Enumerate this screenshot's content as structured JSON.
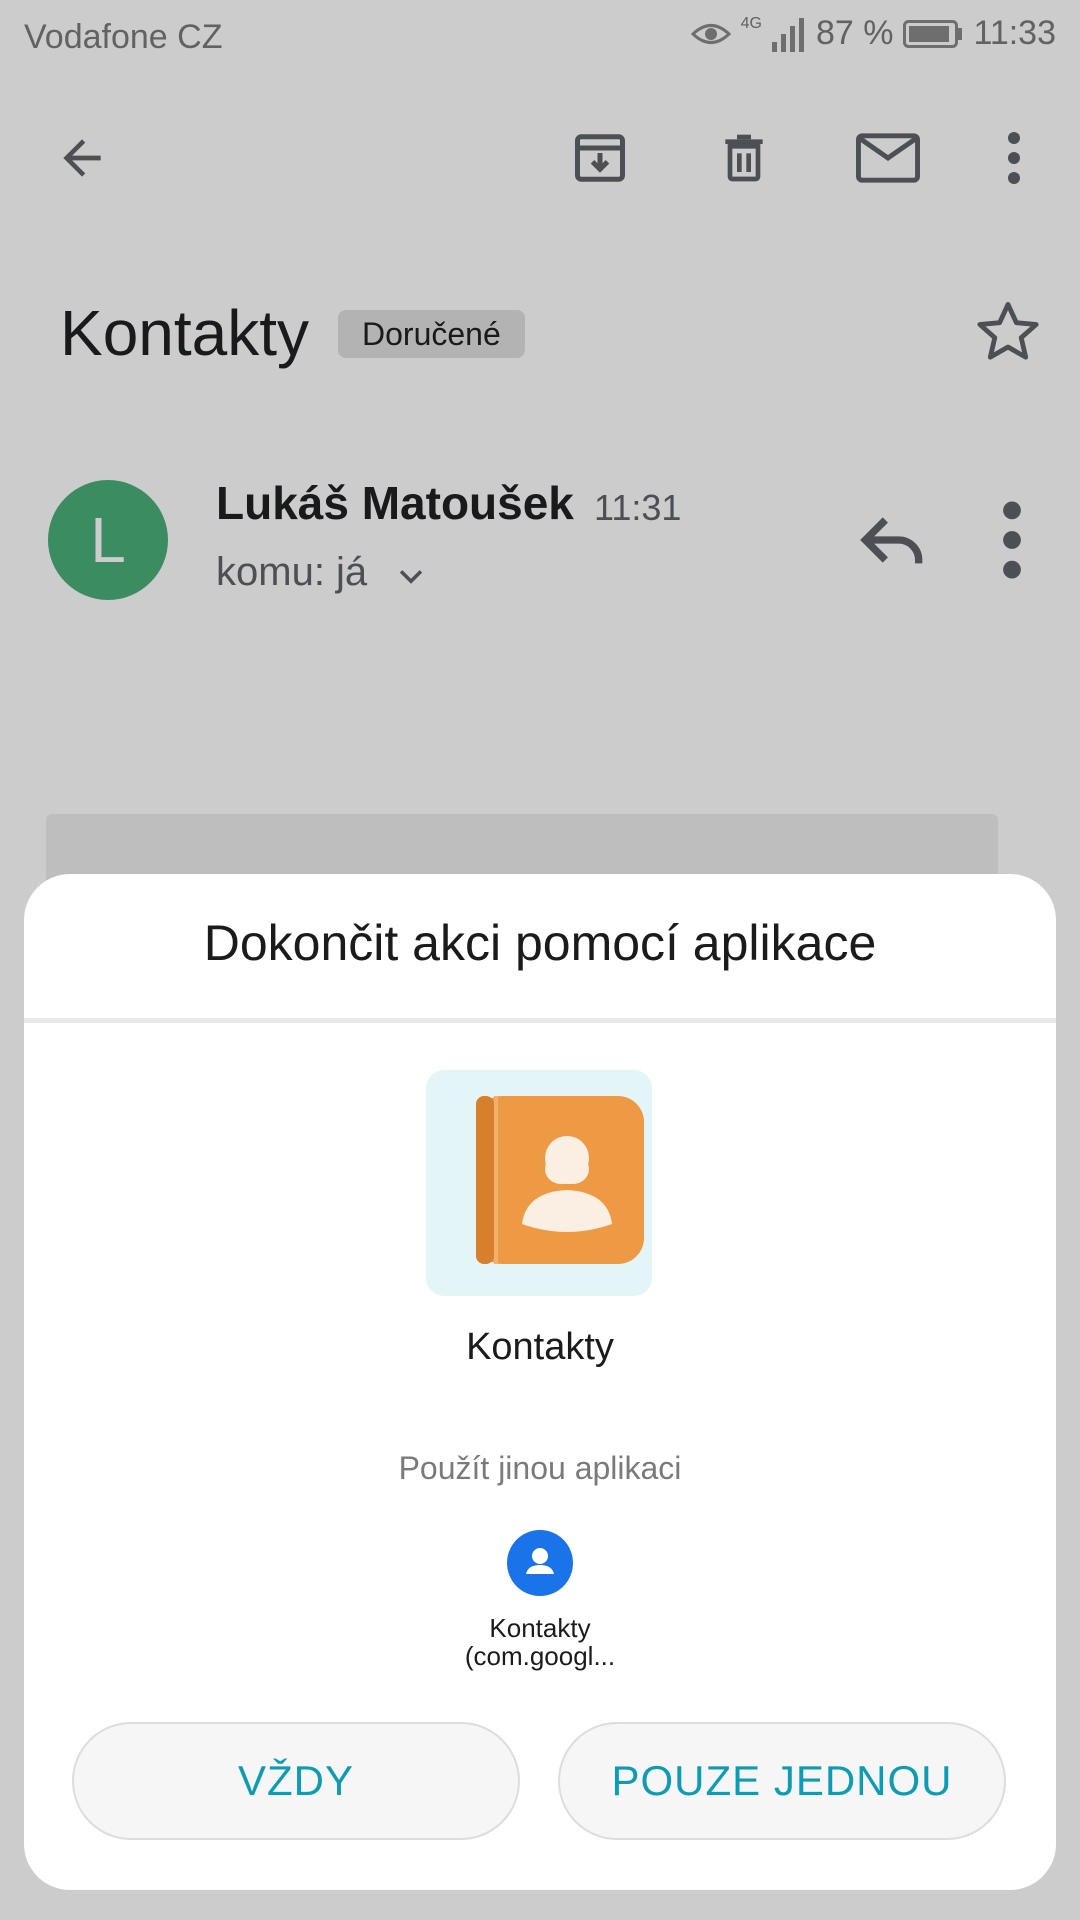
{
  "status_bar": {
    "carrier": "Vodafone CZ",
    "network": "4G",
    "battery": "87 %",
    "time": "11:33",
    "icons": [
      "eye-icon",
      "signal-icon",
      "battery-icon"
    ]
  },
  "toolbar": {
    "icons": [
      "back-arrow-icon",
      "archive-icon",
      "delete-icon",
      "mail-icon",
      "more-vert-icon"
    ]
  },
  "email": {
    "subject": "Kontakty",
    "label": "Doručené",
    "sender_initial": "L",
    "sender_name": "Lukáš Matoušek",
    "time": "11:31",
    "recipient": "komu: já"
  },
  "sheet": {
    "title": "Dokončit akci pomocí aplikace",
    "default_app": "Kontakty",
    "other_hint": "Použít jinou aplikaci",
    "other_app_line1": "Kontakty",
    "other_app_line2": "(com.googl..."
  },
  "buttons": {
    "always": "VŽDY",
    "once": "POUZE JEDNOU"
  },
  "colors": {
    "avatar": "#4caf7a",
    "accent": "#0e9bb4",
    "other_app_icon": "#1a73e8",
    "contacts_icon": "#ee9a44"
  }
}
